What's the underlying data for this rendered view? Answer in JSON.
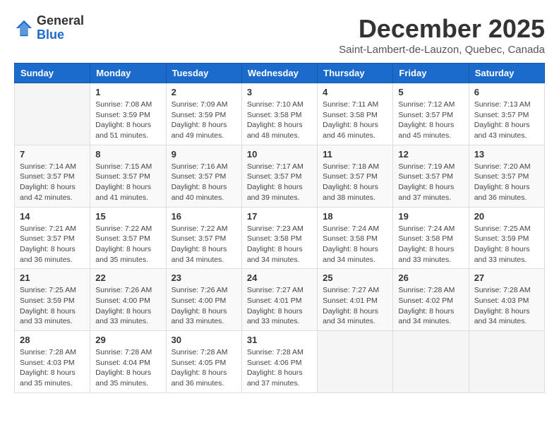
{
  "header": {
    "logo_general": "General",
    "logo_blue": "Blue",
    "month_title": "December 2025",
    "location": "Saint-Lambert-de-Lauzon, Quebec, Canada"
  },
  "weekdays": [
    "Sunday",
    "Monday",
    "Tuesday",
    "Wednesday",
    "Thursday",
    "Friday",
    "Saturday"
  ],
  "weeks": [
    [
      {
        "day": "",
        "info": ""
      },
      {
        "day": "1",
        "info": "Sunrise: 7:08 AM\nSunset: 3:59 PM\nDaylight: 8 hours\nand 51 minutes."
      },
      {
        "day": "2",
        "info": "Sunrise: 7:09 AM\nSunset: 3:59 PM\nDaylight: 8 hours\nand 49 minutes."
      },
      {
        "day": "3",
        "info": "Sunrise: 7:10 AM\nSunset: 3:58 PM\nDaylight: 8 hours\nand 48 minutes."
      },
      {
        "day": "4",
        "info": "Sunrise: 7:11 AM\nSunset: 3:58 PM\nDaylight: 8 hours\nand 46 minutes."
      },
      {
        "day": "5",
        "info": "Sunrise: 7:12 AM\nSunset: 3:57 PM\nDaylight: 8 hours\nand 45 minutes."
      },
      {
        "day": "6",
        "info": "Sunrise: 7:13 AM\nSunset: 3:57 PM\nDaylight: 8 hours\nand 43 minutes."
      }
    ],
    [
      {
        "day": "7",
        "info": "Sunrise: 7:14 AM\nSunset: 3:57 PM\nDaylight: 8 hours\nand 42 minutes."
      },
      {
        "day": "8",
        "info": "Sunrise: 7:15 AM\nSunset: 3:57 PM\nDaylight: 8 hours\nand 41 minutes."
      },
      {
        "day": "9",
        "info": "Sunrise: 7:16 AM\nSunset: 3:57 PM\nDaylight: 8 hours\nand 40 minutes."
      },
      {
        "day": "10",
        "info": "Sunrise: 7:17 AM\nSunset: 3:57 PM\nDaylight: 8 hours\nand 39 minutes."
      },
      {
        "day": "11",
        "info": "Sunrise: 7:18 AM\nSunset: 3:57 PM\nDaylight: 8 hours\nand 38 minutes."
      },
      {
        "day": "12",
        "info": "Sunrise: 7:19 AM\nSunset: 3:57 PM\nDaylight: 8 hours\nand 37 minutes."
      },
      {
        "day": "13",
        "info": "Sunrise: 7:20 AM\nSunset: 3:57 PM\nDaylight: 8 hours\nand 36 minutes."
      }
    ],
    [
      {
        "day": "14",
        "info": "Sunrise: 7:21 AM\nSunset: 3:57 PM\nDaylight: 8 hours\nand 36 minutes."
      },
      {
        "day": "15",
        "info": "Sunrise: 7:22 AM\nSunset: 3:57 PM\nDaylight: 8 hours\nand 35 minutes."
      },
      {
        "day": "16",
        "info": "Sunrise: 7:22 AM\nSunset: 3:57 PM\nDaylight: 8 hours\nand 34 minutes."
      },
      {
        "day": "17",
        "info": "Sunrise: 7:23 AM\nSunset: 3:58 PM\nDaylight: 8 hours\nand 34 minutes."
      },
      {
        "day": "18",
        "info": "Sunrise: 7:24 AM\nSunset: 3:58 PM\nDaylight: 8 hours\nand 34 minutes."
      },
      {
        "day": "19",
        "info": "Sunrise: 7:24 AM\nSunset: 3:58 PM\nDaylight: 8 hours\nand 33 minutes."
      },
      {
        "day": "20",
        "info": "Sunrise: 7:25 AM\nSunset: 3:59 PM\nDaylight: 8 hours\nand 33 minutes."
      }
    ],
    [
      {
        "day": "21",
        "info": "Sunrise: 7:25 AM\nSunset: 3:59 PM\nDaylight: 8 hours\nand 33 minutes."
      },
      {
        "day": "22",
        "info": "Sunrise: 7:26 AM\nSunset: 4:00 PM\nDaylight: 8 hours\nand 33 minutes."
      },
      {
        "day": "23",
        "info": "Sunrise: 7:26 AM\nSunset: 4:00 PM\nDaylight: 8 hours\nand 33 minutes."
      },
      {
        "day": "24",
        "info": "Sunrise: 7:27 AM\nSunset: 4:01 PM\nDaylight: 8 hours\nand 33 minutes."
      },
      {
        "day": "25",
        "info": "Sunrise: 7:27 AM\nSunset: 4:01 PM\nDaylight: 8 hours\nand 34 minutes."
      },
      {
        "day": "26",
        "info": "Sunrise: 7:28 AM\nSunset: 4:02 PM\nDaylight: 8 hours\nand 34 minutes."
      },
      {
        "day": "27",
        "info": "Sunrise: 7:28 AM\nSunset: 4:03 PM\nDaylight: 8 hours\nand 34 minutes."
      }
    ],
    [
      {
        "day": "28",
        "info": "Sunrise: 7:28 AM\nSunset: 4:03 PM\nDaylight: 8 hours\nand 35 minutes."
      },
      {
        "day": "29",
        "info": "Sunrise: 7:28 AM\nSunset: 4:04 PM\nDaylight: 8 hours\nand 35 minutes."
      },
      {
        "day": "30",
        "info": "Sunrise: 7:28 AM\nSunset: 4:05 PM\nDaylight: 8 hours\nand 36 minutes."
      },
      {
        "day": "31",
        "info": "Sunrise: 7:28 AM\nSunset: 4:06 PM\nDaylight: 8 hours\nand 37 minutes."
      },
      {
        "day": "",
        "info": ""
      },
      {
        "day": "",
        "info": ""
      },
      {
        "day": "",
        "info": ""
      }
    ]
  ]
}
